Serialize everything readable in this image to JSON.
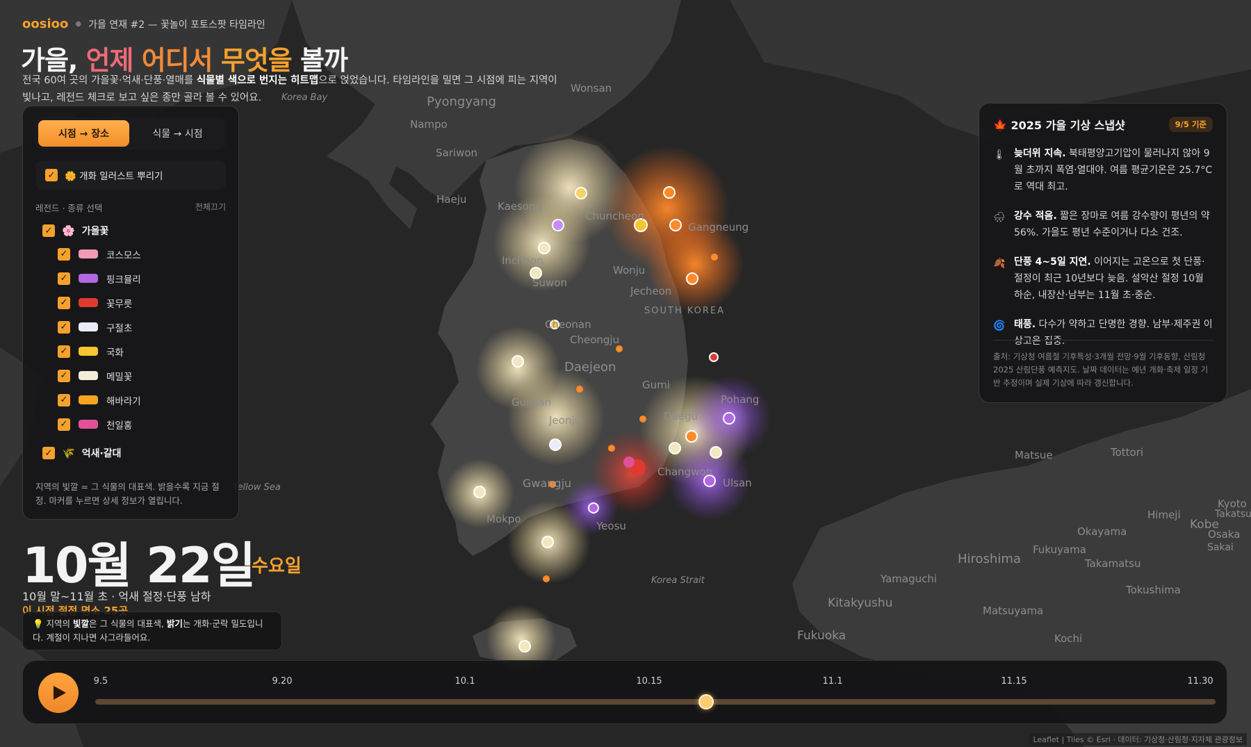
{
  "header": {
    "brand": "oosioo",
    "kicker": "가을 연재 #2 — 꽃놀이 포토스팟 타임라인",
    "title_parts": [
      "가을, ",
      "언제 ",
      "어디서 ",
      "무엇을 ",
      "볼까"
    ],
    "intro_1": "전국 60여 곳의 가을꽃·억새·단풍·열매를 ",
    "intro_bold": "식물별 색으로 번지는 히트맵",
    "intro_2": "으로 얹었습니다. 타임라인을 밀면 그 시점에 피는 지역이 빛나고, 레전드 체크로 보고 싶은 종만 골라 볼 수 있어요."
  },
  "panel": {
    "mode_tabs": [
      {
        "label": "시점 → 장소",
        "active": true
      },
      {
        "label": "식물 → 시점",
        "active": false
      }
    ],
    "illust_toggle": {
      "label": "🌼 개화 일러스트 뿌리기",
      "checked": true
    },
    "legend_title": "레전드 · 종류 선택",
    "legend_all_off": "전체끄기",
    "group_autumn": {
      "icon": "🌸",
      "label": "가을꽃",
      "checked": true
    },
    "items": [
      {
        "label": "코스모스",
        "color": "#f39ab4"
      },
      {
        "label": "핑크뮬리",
        "color": "#b069e0"
      },
      {
        "label": "꽃무릇",
        "color": "#e03a30"
      },
      {
        "label": "구절초",
        "color": "#e9ecf7"
      },
      {
        "label": "국화",
        "color": "#f7c531"
      },
      {
        "label": "메밀꽃",
        "color": "#f3ecd9"
      },
      {
        "label": "해바라기",
        "color": "#f5a51f"
      },
      {
        "label": "천일홍",
        "color": "#e0519a"
      }
    ],
    "group_reed": {
      "icon": "🌾",
      "label": "억새·갈대",
      "checked": true
    },
    "note": "지역의 빛깔 = 그 식물의 대표색. 밝을수록 지금 절정. 마커를 누르면 상세 정보가 열립니다."
  },
  "date": {
    "big": "10월 22일",
    "weekday": "수요일",
    "season": "10월 말~11월 초 · 억새 절정·단풍 남하",
    "count": "이 시점 절정 명소 25곳",
    "tip_1": "💡 지역의 ",
    "tip_b1": "빛깔",
    "tip_2": "은 그 식물의 대표색, ",
    "tip_b2": "밝기",
    "tip_3": "는 개화·군락 밀도입니다. 계절이 지나면 사그라들어요."
  },
  "card": {
    "title": "🍁 2025 가을 기상 스냅샷",
    "badge": "9/5 기준",
    "items": [
      {
        "icon": "🌡",
        "bold": "늦더위 지속.",
        "text": " 북태평양고기압이 물러나지 않아 9월 초까지 폭염·열대야. 여름 평균기온은 25.7°C로 역대 최고."
      },
      {
        "icon": "🌧",
        "bold": "강수 적음.",
        "text": " 짧은 장마로 여름 강수량이 평년의 약 56%. 가을도 평년 수준이거나 다소 건조."
      },
      {
        "icon": "🍂",
        "bold": "단풍 4~5일 지연.",
        "text": " 이어지는 고온으로 첫 단풍·절정이 최근 10년보다 늦음. 설악산 절정 10월 하순, 내장산·남부는 11월 초·중순."
      },
      {
        "icon": "🌀",
        "bold": "태풍.",
        "text": " 다수가 약하고 단명한 경향. 남부·제주권 이상고온 집중."
      }
    ],
    "source": "출처: 기상청 여름철 기후특성·3개월 전망·9월 기후동향, 산림청 2025 산림단풍 예측지도. 날짜 데이터는 예년 개화·축제 일정 기반 추정이며 실제 기상에 따라 갱신합니다."
  },
  "timeline": {
    "ticks": [
      "9.5",
      "9.20",
      "10.1",
      "10.15",
      "11.1",
      "11.15",
      "11.30"
    ],
    "progress": 0.545
  },
  "map_labels": {
    "cities": [
      "Pyongyang",
      "Nampo",
      "Sariwon",
      "Haeju",
      "Kaesong",
      "Wonsan",
      "Chuncheon",
      "Gangneung",
      "Incheon",
      "Suwon",
      "Wonju",
      "Jecheon",
      "SOUTH KOREA",
      "Cheonan",
      "Cheongju",
      "Daejeon",
      "Gumi",
      "Pohang",
      "Gunsan",
      "Jeonju",
      "Daegu",
      "Gwangju",
      "Changwon",
      "Ulsan",
      "Mokpo",
      "Yeosu",
      "Korea Strait",
      "Matsue",
      "Tottori",
      "Okayama",
      "Himeji",
      "Kobe",
      "Osaka",
      "Sakai",
      "Kyoto",
      "Takatsuki",
      "Hiroshima",
      "Fukuyama",
      "Takamatsu",
      "Tokushima",
      "Matsuyama",
      "Yamaguchi",
      "Kitakyushu",
      "Fukuoka",
      "Kochi",
      "Korea Bay",
      "Yellow Sea"
    ],
    "attribution": "Leaflet | Tiles © Esri · 데이터: 기상청·산림청·지자체 관광정보"
  }
}
